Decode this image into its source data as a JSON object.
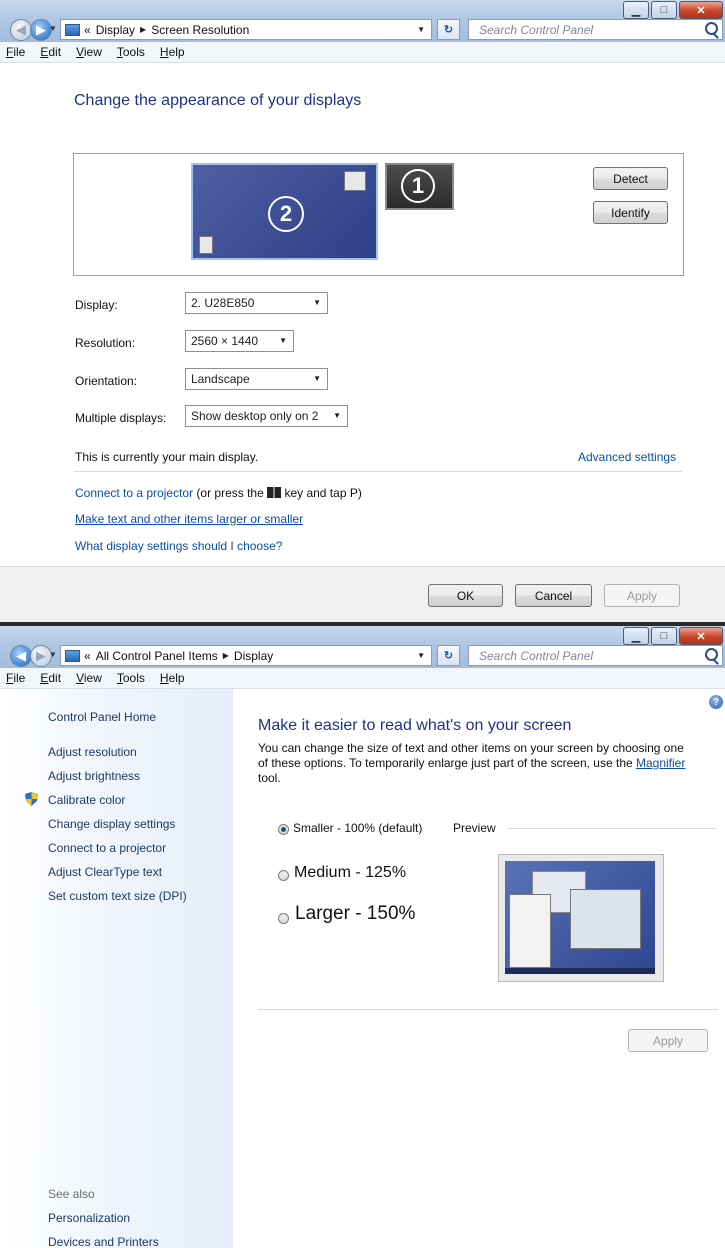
{
  "window1": {
    "breadcrumb": {
      "prefix": "«",
      "item1": "Display",
      "item2": "Screen Resolution"
    },
    "search_placeholder": "Search Control Panel",
    "menu": [
      "File",
      "Edit",
      "View",
      "Tools",
      "Help"
    ],
    "heading": "Change the appearance of your displays",
    "monitors": {
      "primary_number": "1",
      "secondary_number": "2"
    },
    "detect_label": "Detect",
    "identify_label": "Identify",
    "display_label": "Display:",
    "display_value": "2. U28E850",
    "resolution_label": "Resolution:",
    "resolution_value": "2560 × 1440",
    "orientation_label": "Orientation:",
    "orientation_value": "Landscape",
    "multiple_label": "Multiple displays:",
    "multiple_value": "Show desktop only on 2",
    "main_display_text": "This is currently your main display.",
    "advanced_settings": "Advanced settings",
    "projector_link": "Connect to a projector",
    "projector_rest": " (or press the ",
    "projector_rest2": " key and tap P)",
    "larger_link": "Make text and other items larger or smaller",
    "settings_link": "What display settings should I choose?",
    "ok": "OK",
    "cancel": "Cancel",
    "apply": "Apply"
  },
  "window2": {
    "breadcrumb": {
      "prefix": "«",
      "item1": "All Control Panel Items",
      "item2": "Display"
    },
    "search_placeholder": "Search Control Panel",
    "menu": [
      "File",
      "Edit",
      "View",
      "Tools",
      "Help"
    ],
    "left_pane": {
      "home": "Control Panel Home",
      "items": [
        "Adjust resolution",
        "Adjust brightness",
        "Calibrate color",
        "Change display settings",
        "Connect to a projector",
        "Adjust ClearType text",
        "Set custom text size (DPI)"
      ],
      "see_also": "See also",
      "see_also_items": [
        "Personalization",
        "Devices and Printers"
      ]
    },
    "heading": "Make it easier to read what's on your screen",
    "desc_1": "You can change the size of text and other items on your screen by choosing one",
    "desc_2": "of these options. To temporarily enlarge just part of the screen, use the ",
    "desc_link": "Magnifier",
    "desc_3": "tool.",
    "options": [
      "Smaller - 100% (default)",
      "Medium - 125%",
      "Larger - 150%"
    ],
    "selected_option": 0,
    "preview_label": "Preview",
    "apply": "Apply"
  }
}
